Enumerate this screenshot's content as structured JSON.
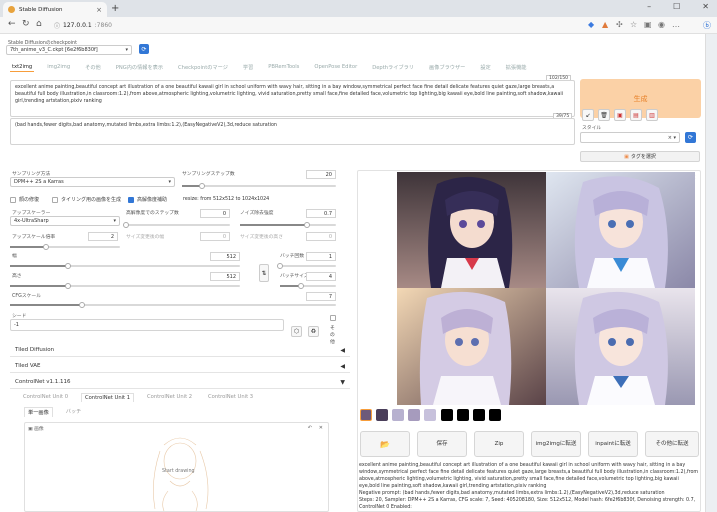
{
  "browser": {
    "tab_title": "Stable Diffusion",
    "url_host": "127.0.0.1",
    "url_port": ":7860"
  },
  "checkpoint": {
    "label": "Stable Diffusionのcheckpoint",
    "value": "7th_anime_v3_C.ckpt [6e2f6b830f]"
  },
  "tabs": [
    "txt2img",
    "img2img",
    "その他",
    "PNG内の情報を表示",
    "Checkpointのマージ",
    "学習",
    "PBRemTools",
    "OpenPose Editor",
    "Depthライブラリ",
    "画像ブラウザー",
    "設定",
    "拡張機能"
  ],
  "prompt": {
    "positive": "excellent anime painting,beautiful concept art illustration of a one beautiful kawaii girl in school uniform with wavy hair, sitting in a bay window,symmetrical perfect face fine detail delicate features quiet gaze,large breasts,a beautiful full body illustration,in classroom:1.2),from above,atmospheric lighting,volumetric lighting, vivid saturation,pretty small face,fine detailed face,volumetric top lighting,big kawaii eye,bold line painting,soft shadow,kawaii girl,trending artstation,pixiv ranking",
    "positive_count": "102/150",
    "negative": "(bad hands,fewer digits,bad anatomy,mutated limbs,extra limbs:1.2),(EasyNegativeV2),3d,reduce saturation",
    "negative_count": "39/75"
  },
  "generate_label": "生成",
  "style": {
    "label": "スタイル",
    "select_btn": "タグを選択"
  },
  "params": {
    "sampler_label": "サンプリング方法",
    "sampler_value": "DPM++ 2S a Karras",
    "steps_label": "サンプリングステップ数",
    "steps_value": "20",
    "steps_frac": 0.13,
    "face_restore": "顔の修復",
    "tiling": "タイリング用の画像を生成",
    "hires": "高解像度補助",
    "resize_text": "resize: from 512x512 to 1024x1024",
    "upscaler_label": "アップスケーラー",
    "upscaler_value": "4x-UltraSharp",
    "hires_steps_label": "高解像度でのステップ数",
    "hires_steps_value": "0",
    "denoise_label": "ノイズ除去強度",
    "denoise_value": "0.7",
    "denoise_frac": 0.7,
    "upscale_by_label": "アップスケール倍率",
    "upscale_by_value": "2",
    "upscale_by_frac": 0.33,
    "resize_w_label": "サイズ変更後の幅",
    "resize_w_value": "0",
    "resize_h_label": "サイズ変更後の高さ",
    "resize_h_value": "0",
    "width_label": "幅",
    "width_value": "512",
    "width_frac": 0.25,
    "height_label": "高さ",
    "height_value": "512",
    "height_frac": 0.25,
    "batch_count_label": "バッチ回数",
    "batch_count_value": "1",
    "batch_count_frac": 0.0,
    "batch_size_label": "バッチサイズ",
    "batch_size_value": "4",
    "batch_size_frac": 0.38,
    "cfg_label": "CFGスケール",
    "cfg_value": "7",
    "cfg_frac": 0.22,
    "seed_label": "シード",
    "seed_value": "-1",
    "extra_label": "その他"
  },
  "accordions": {
    "tiled_diffusion": "Tiled Diffusion",
    "tiled_vae": "Tiled VAE",
    "controlnet": "ControlNet v1.1.116"
  },
  "controlnet": {
    "units": [
      "ControlNet Unit 0",
      "ControlNet Unit 1",
      "ControlNet Unit 2",
      "ControlNet Unit 3"
    ],
    "subtabs": [
      "単一画像",
      "バッチ"
    ],
    "image_label": "画像",
    "start_drawing": "Start drawing"
  },
  "output": {
    "buttons": [
      "保存",
      "Zip",
      "img2imgに転送",
      "inpaintに転送",
      "その他に転送"
    ],
    "info": "excellent anime painting,beautiful concept art illustration of a one beautiful kawaii girl in school uniform with wavy hair, sitting in a bay window,symmetrical perfect face fine detail delicate features quiet gaze,large breasts,a beautiful full body illustration,in classroom:1.2),from above,atmospheric lighting,volumetric lighting, vivid saturation,pretty small face,fine detailed face,volumetric top lighting,big kawaii eye,bold line painting,soft shadow,kawaii girl,trending artstation,pixiv ranking",
    "negative_info": "Negative prompt: (bad hands,fewer digits,bad anatomy,mutated limbs,extra limbs:1.2),(EasyNegativeV2),3d,reduce saturation",
    "steps_info": "Steps: 20, Sampler: DPM++ 2S a Karras, CFG scale: 7, Seed: 405208180, Size: 512x512, Model hash: 6fe2f6b830f, Denoising strength: 0.7, ControlNet 0 Enabled:"
  },
  "colors": {
    "accent": "#f79d3b",
    "generate_bg": "#fbd1a6",
    "generate_text": "#e8822a",
    "check_on": "#3277d6"
  }
}
